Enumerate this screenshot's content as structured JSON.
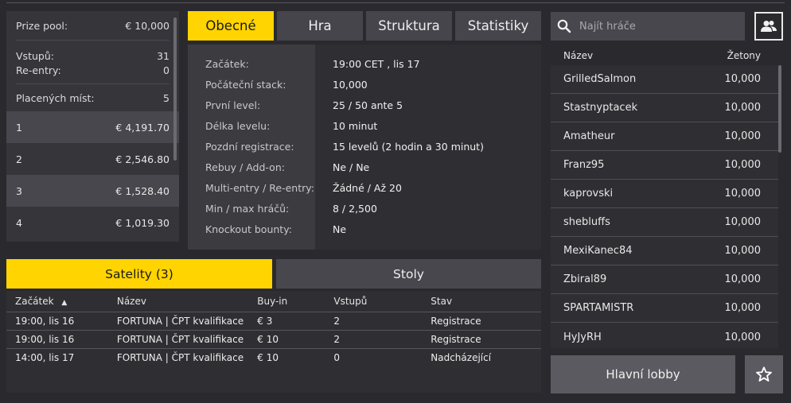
{
  "summary": {
    "prize_pool_label": "Prize pool:",
    "prize_pool_value": "€ 10,000",
    "entries_label": "Vstupů:",
    "entries_value": "31",
    "reentry_label": "Re-entry:",
    "reentry_value": "0",
    "paid_label": "Placených míst:",
    "paid_value": "5",
    "places": [
      {
        "rank": "1",
        "prize": "€ 4,191.70"
      },
      {
        "rank": "2",
        "prize": "€ 2,546.80"
      },
      {
        "rank": "3",
        "prize": "€ 1,528.40"
      },
      {
        "rank": "4",
        "prize": "€ 1,019.30"
      }
    ]
  },
  "tabs": [
    {
      "label": "Obecné",
      "active": true
    },
    {
      "label": "Hra",
      "active": false
    },
    {
      "label": "Struktura",
      "active": false
    },
    {
      "label": "Statistiky",
      "active": false
    }
  ],
  "info": [
    {
      "label": "Začátek:",
      "value": "19:00 CET , lis 17"
    },
    {
      "label": "Počáteční stack:",
      "value": "10,000"
    },
    {
      "label": "První level:",
      "value": "25 / 50 ante 5"
    },
    {
      "label": "Délka levelu:",
      "value": "10 minut"
    },
    {
      "label": "Pozdní registrace:",
      "value": "15 levelů (2 hodin a 30 minut)"
    },
    {
      "label": "Rebuy / Add-on:",
      "value": "Ne / Ne"
    },
    {
      "label": "Multi-entry / Re-entry:",
      "value": "Žádné / Až 20"
    },
    {
      "label": "Min / max hráčů:",
      "value": "8 / 2,500"
    },
    {
      "label": "Knockout bounty:",
      "value": "Ne"
    }
  ],
  "bottom_tabs": [
    {
      "label": "Satelity (3)",
      "active": true
    },
    {
      "label": "Stoly",
      "active": false
    }
  ],
  "satellites": {
    "headers": [
      "Začátek",
      "Název",
      "Buy-in",
      "Vstupů",
      "Stav"
    ],
    "sort_indicator": "▲",
    "rows": [
      [
        "19:00, lis 16",
        "FORTUNA | ČPT kvalifikace",
        "€ 3",
        "2",
        "Registrace"
      ],
      [
        "19:00, lis 16",
        "FORTUNA | ČPT kvalifikace",
        "€ 10",
        "2",
        "Registrace"
      ],
      [
        "14:00, lis 17",
        "FORTUNA | ČPT kvalifikace",
        "€ 10",
        "0",
        "Nadcházející"
      ]
    ]
  },
  "search": {
    "placeholder": "Najít hráče"
  },
  "players": {
    "col_name": "Název",
    "col_chips": "Žetony",
    "rows": [
      {
        "name": "GrilledSalmon",
        "chips": "10,000"
      },
      {
        "name": "Stastnyptacek",
        "chips": "10,000"
      },
      {
        "name": "Amatheur",
        "chips": "10,000"
      },
      {
        "name": "Franz95",
        "chips": "10,000"
      },
      {
        "name": "kaprovski",
        "chips": "10,000"
      },
      {
        "name": "shebluffs",
        "chips": "10,000"
      },
      {
        "name": "MexiKanec84",
        "chips": "10,000"
      },
      {
        "name": "Zbiral89",
        "chips": "10,000"
      },
      {
        "name": "SPARTAMISTR",
        "chips": "10,000"
      },
      {
        "name": "HyJyRH",
        "chips": "10,000"
      }
    ]
  },
  "lobby_button": "Hlavní lobby",
  "icons": {
    "search": "search-icon",
    "players": "players-icon",
    "favorite": "star-icon"
  },
  "colors": {
    "accent": "#ffd400",
    "panel": "#35353a",
    "background": "#2a2a2e"
  }
}
